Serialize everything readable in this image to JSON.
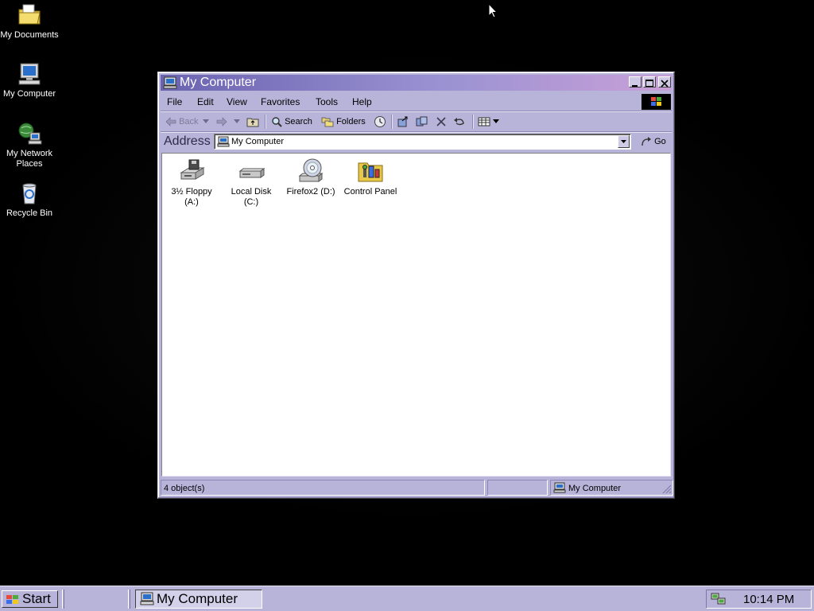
{
  "desktop": {
    "icons": [
      {
        "label": "My Documents",
        "icon": "folder-documents-icon"
      },
      {
        "label": "My Computer",
        "icon": "computer-icon"
      },
      {
        "label": "My Network Places",
        "icon": "network-places-icon"
      },
      {
        "label": "Recycle Bin",
        "icon": "recycle-bin-icon"
      }
    ]
  },
  "window": {
    "title": "My Computer",
    "menu": [
      "File",
      "Edit",
      "View",
      "Favorites",
      "Tools",
      "Help"
    ],
    "toolbar": {
      "back": "Back",
      "search": "Search",
      "folders": "Folders"
    },
    "address": {
      "label": "Address",
      "value": "My Computer",
      "go": "Go"
    },
    "items": [
      {
        "label": "3½ Floppy (A:)",
        "icon": "floppy-drive-icon"
      },
      {
        "label": "Local Disk (C:)",
        "icon": "hard-disk-icon"
      },
      {
        "label": "Firefox2 (D:)",
        "icon": "cd-drive-icon"
      },
      {
        "label": "Control Panel",
        "icon": "control-panel-icon"
      }
    ],
    "status": {
      "objects": "4 object(s)",
      "zone": "My Computer"
    }
  },
  "taskbar": {
    "start": "Start",
    "tasks": [
      {
        "label": "My Computer"
      }
    ],
    "clock": "10:14 PM"
  },
  "colors": {
    "titlebar_start": "#6a63b0",
    "titlebar_end": "#c9a0d8",
    "chrome": "#b8b3d9",
    "desktop": "#000000"
  }
}
